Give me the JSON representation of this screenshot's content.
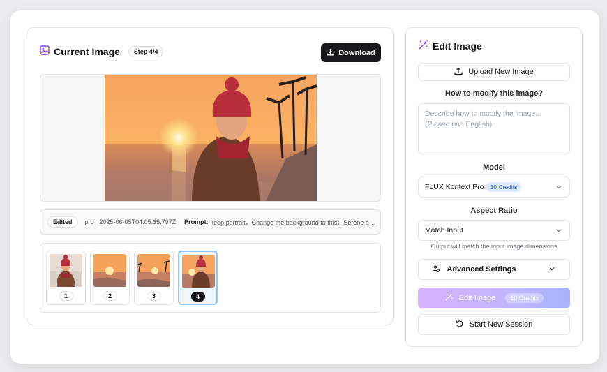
{
  "current": {
    "title": "Current Image",
    "step": "Step 4/4",
    "download_label": "Download",
    "meta": {
      "tag": "Edited",
      "model": "pro",
      "date": "2025-06-05T04:05:35.797Z",
      "prompt_label": "Prompt:",
      "prompt_text": "keep portrait，Change the background to this：Serene b…"
    },
    "thumbnails": [
      {
        "num": "1",
        "selected": false
      },
      {
        "num": "2",
        "selected": false
      },
      {
        "num": "3",
        "selected": false
      },
      {
        "num": "4",
        "selected": true
      }
    ]
  },
  "edit": {
    "title": "Edit Image",
    "upload_label": "Upload New Image",
    "modify_label": "How to modify this image?",
    "prompt_placeholder": "Describe how to modify the image...\n(Please use English)",
    "model_label": "Model",
    "model_value": "FLUX Kontext Pro",
    "model_credits": "10 Credits",
    "aspect_label": "Aspect Ratio",
    "aspect_value": "Match Input",
    "aspect_note": "Output will match the input image dimensions",
    "advanced_label": "Advanced Settings",
    "edit_button": "Edit Image",
    "edit_credits": "10 Credits",
    "new_session": "Start New Session"
  },
  "colors": {
    "accent_purple": "#9333ea",
    "download_bg": "#18181b",
    "selected_border": "#93c5fd"
  }
}
